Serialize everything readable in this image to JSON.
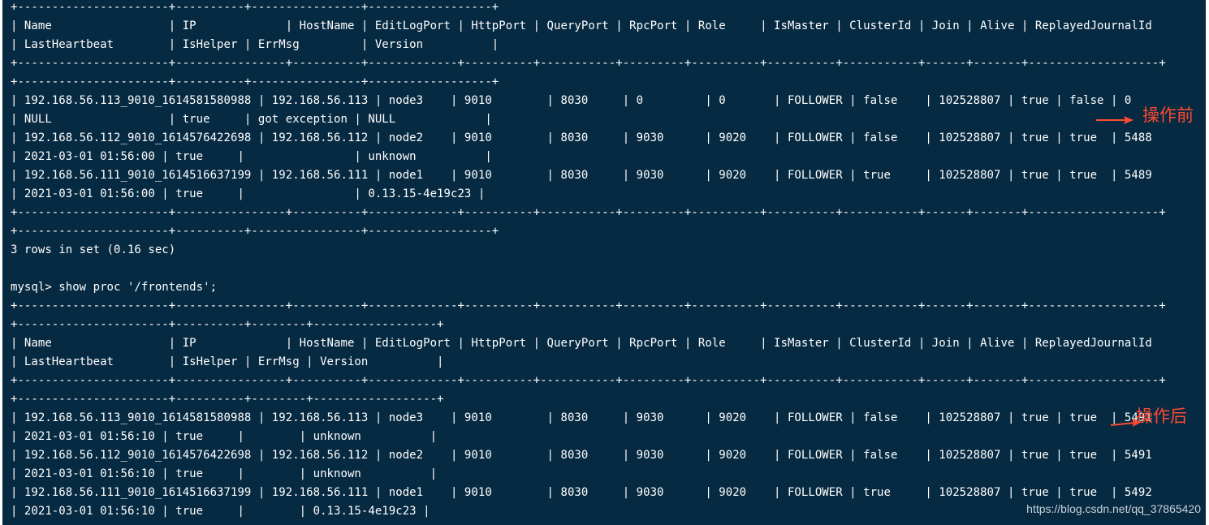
{
  "terminal": {
    "lines": [
      "+----------------------+----------+----------------+------------------+",
      "| Name                 | IP             | HostName | EditLogPort | HttpPort | QueryPort | RpcPort | Role     | IsMaster | ClusterId | Join | Alive | ReplayedJournalId",
      "| LastHeartbeat        | IsHelper | ErrMsg         | Version          |",
      "+----------------------+----------------+----------+-------------+----------+-----------+---------+----------+----------+-----------+------+-------+-------------------+",
      "+----------------------+----------+----------------+------------------+",
      "| 192.168.56.113_9010_1614581580988 | 192.168.56.113 | node3    | 9010        | 8030     | 0         | 0       | FOLLOWER | false    | 102528807 | true | false | 0",
      "| NULL                 | true     | got exception | NULL             |",
      "| 192.168.56.112_9010_1614576422698 | 192.168.56.112 | node2    | 9010        | 8030     | 9030      | 9020    | FOLLOWER | false    | 102528807 | true | true  | 5488",
      "| 2021-03-01 01:56:00 | true     |                | unknown          |",
      "| 192.168.56.111_9010_1614516637199 | 192.168.56.111 | node1    | 9010        | 8030     | 9030      | 9020    | FOLLOWER | true     | 102528807 | true | true  | 5489",
      "| 2021-03-01 01:56:00 | true     |                | 0.13.15-4e19c23 |",
      "+----------------------+----------------+----------+-------------+----------+-----------+---------+----------+----------+-----------+------+-------+-------------------+",
      "+----------------------+----------+----------------+------------------+",
      "3 rows in set (0.16 sec)",
      "",
      "mysql> show proc '/frontends';",
      "+----------------------+----------------+----------+-------------+----------+-----------+---------+----------+----------+-----------+------+-------+-------------------+",
      "+----------------------+----------+--------+------------------+",
      "| Name                 | IP             | HostName | EditLogPort | HttpPort | QueryPort | RpcPort | Role     | IsMaster | ClusterId | Join | Alive | ReplayedJournalId",
      "| LastHeartbeat        | IsHelper | ErrMsg | Version          |",
      "+----------------------+----------------+----------+-------------+----------+-----------+---------+----------+----------+-----------+------+-------+-------------------+",
      "+----------------------+----------+--------+------------------+",
      "| 192.168.56.113_9010_1614581580988 | 192.168.56.113 | node3    | 9010        | 8030     | 9030      | 9020    | FOLLOWER | false    | 102528807 | true | true  | 5491",
      "| 2021-03-01 01:56:10 | true     |        | unknown          |",
      "| 192.168.56.112_9010_1614576422698 | 192.168.56.112 | node2    | 9010        | 8030     | 9030      | 9020    | FOLLOWER | false    | 102528807 | true | true  | 5491",
      "| 2021-03-01 01:56:10 | true     |        | unknown          |",
      "| 192.168.56.111_9010_1614516637199 | 192.168.56.111 | node1    | 9010        | 8030     | 9030      | 9020    | FOLLOWER | true     | 102528807 | true | true  | 5492",
      "| 2021-03-01 01:56:10 | true     |        | 0.13.15-4e19c23 |"
    ]
  },
  "annotations": {
    "before": "操作前",
    "after": "操作后"
  },
  "watermark": "https://blog.csdn.net/qq_37865420",
  "colors": {
    "terminal_background": "#062a42",
    "terminal_text": "#ffffff",
    "annotation": "#ff4a32"
  }
}
